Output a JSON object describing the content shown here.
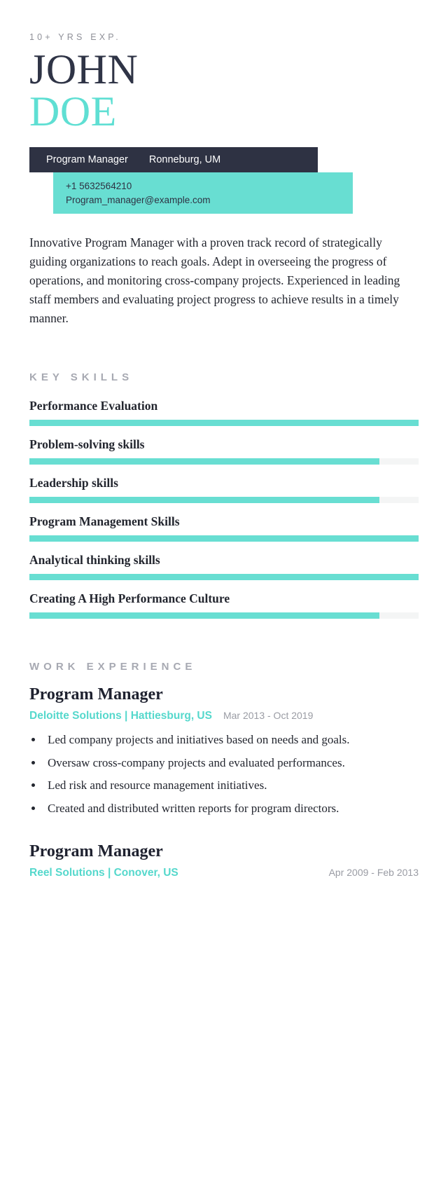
{
  "header": {
    "eyebrow": "10+ YRS EXP.",
    "first_name": "JOHN",
    "last_name": "DOE",
    "role": "Program Manager",
    "location": "Ronneburg, UM",
    "phone": "+1 5632564210",
    "email": "Program_manager@example.com",
    "accent_color": "#68ded2",
    "dark_color": "#2e3243"
  },
  "summary": {
    "text": "Innovative Program Manager with a proven track record of strategically guiding organizations to reach goals. Adept in overseeing the progress of operations, and monitoring cross-company projects. Experienced in leading staff members and evaluating project progress to achieve results in a timely manner."
  },
  "key_skills": {
    "title": "KEY SKILLS",
    "items": [
      {
        "name": "Performance Evaluation",
        "level": 100
      },
      {
        "name": "Problem-solving skills",
        "level": 90
      },
      {
        "name": "Leadership skills",
        "level": 90
      },
      {
        "name": "Program Management Skills",
        "level": 100
      },
      {
        "name": "Analytical thinking skills",
        "level": 100
      },
      {
        "name": "Creating A High Performance Culture",
        "level": 90
      }
    ]
  },
  "work_experience": {
    "title": "WORK EXPERIENCE",
    "jobs": [
      {
        "title": "Program Manager",
        "company": "Deloitte Solutions | Hattiesburg, US",
        "dates": "Mar 2013 - Oct 2019",
        "bullets": [
          "Led company projects and initiatives based on needs and goals.",
          "Oversaw cross-company projects and evaluated performances.",
          "Led risk and resource management initiatives.",
          "Created and distributed written reports for program directors."
        ]
      },
      {
        "title": "Program Manager",
        "company": "Reel Solutions | Conover, US",
        "dates": "Apr 2009 - Feb 2013",
        "bullets": []
      }
    ]
  }
}
